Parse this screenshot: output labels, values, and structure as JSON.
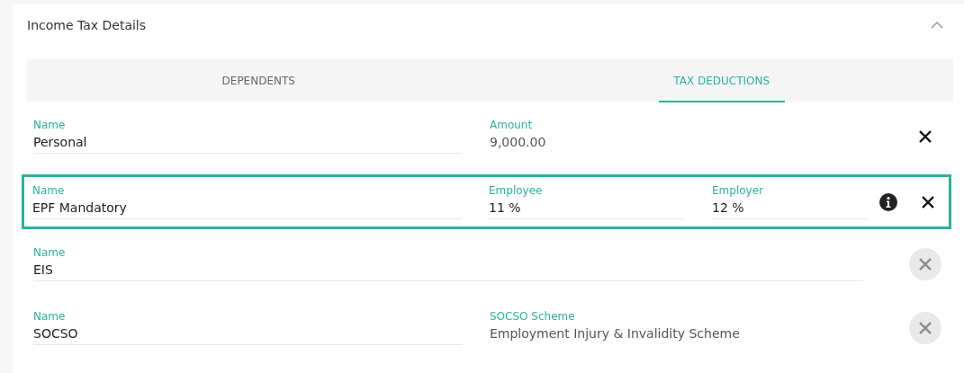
{
  "panel": {
    "title": "Income Tax Details",
    "expanded": true
  },
  "tabs": [
    {
      "label": "DEPENDENTS",
      "selected": false
    },
    {
      "label": "TAX DEDUCTIONS",
      "selected": true
    }
  ],
  "rows": [
    {
      "highlighted": false,
      "info": false,
      "remove_disabled": false,
      "fields": [
        {
          "label": "Name",
          "value": "Personal",
          "kind": "input"
        },
        {
          "label": "Amount",
          "value": "9,000.00",
          "kind": "readonly"
        }
      ]
    },
    {
      "highlighted": true,
      "info": true,
      "remove_disabled": false,
      "fields": [
        {
          "label": "Name",
          "value": "EPF Mandatory",
          "kind": "input"
        },
        {
          "label": "Employee",
          "value": "11 %",
          "kind": "input"
        },
        {
          "label": "Employer",
          "value": "12 %",
          "kind": "input"
        }
      ]
    },
    {
      "highlighted": false,
      "info": false,
      "remove_disabled": true,
      "fields": [
        {
          "label": "Name",
          "value": "EIS",
          "kind": "input"
        }
      ]
    },
    {
      "highlighted": false,
      "info": false,
      "remove_disabled": true,
      "fields": [
        {
          "label": "Name",
          "value": "SOCSO",
          "kind": "input"
        },
        {
          "label": "SOCSO Scheme",
          "value": "Employment Injury & Invalidity Scheme",
          "kind": "readonly"
        }
      ]
    }
  ]
}
